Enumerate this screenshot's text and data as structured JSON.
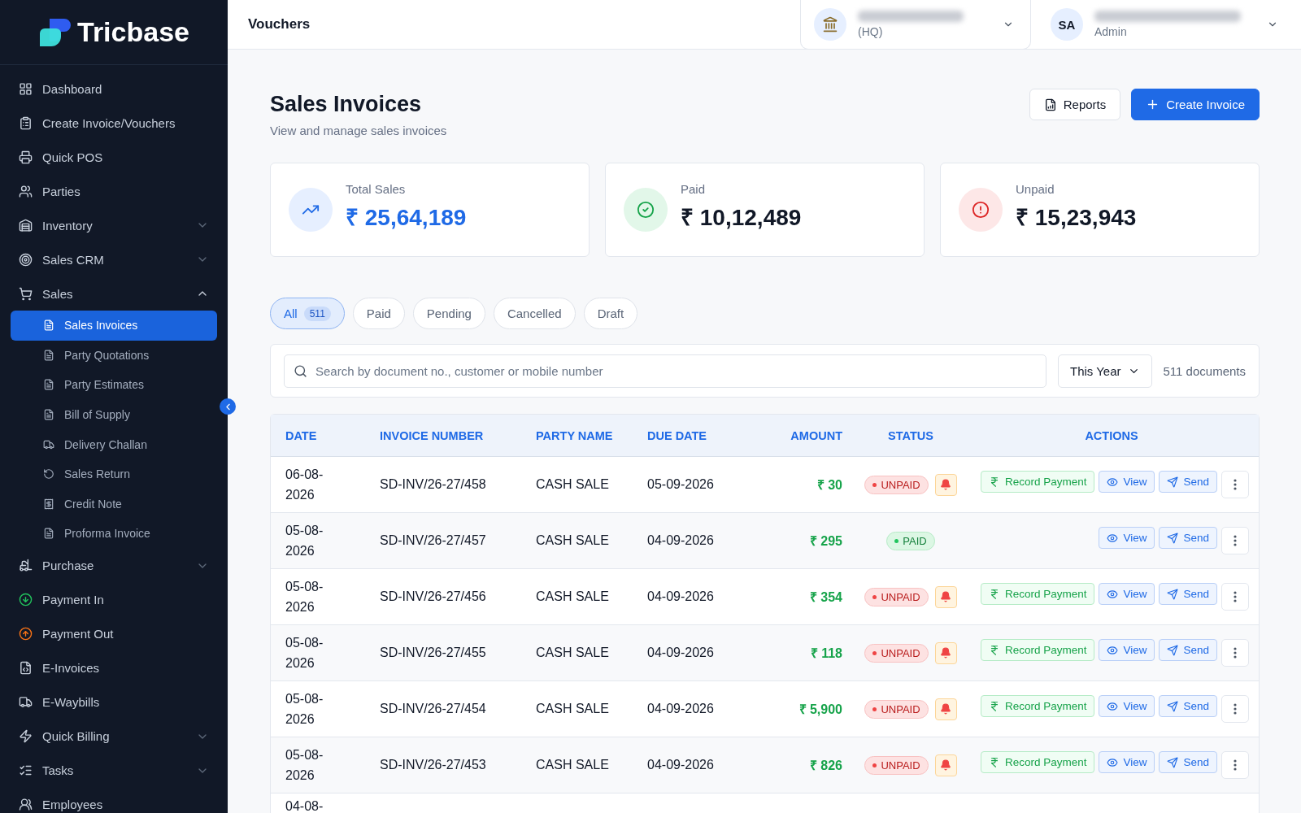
{
  "brand": {
    "name": "Tricbase"
  },
  "sidebar": {
    "items": [
      {
        "label": "Dashboard",
        "kind": "item"
      },
      {
        "label": "Create Invoice/Vouchers",
        "kind": "item"
      },
      {
        "label": "Quick POS",
        "kind": "item"
      },
      {
        "label": "Parties",
        "kind": "item"
      },
      {
        "label": "Inventory",
        "kind": "group",
        "expanded": false
      },
      {
        "label": "Sales CRM",
        "kind": "group",
        "expanded": false
      },
      {
        "label": "Sales",
        "kind": "group",
        "expanded": true,
        "children": [
          {
            "label": "Sales Invoices",
            "selected": true
          },
          {
            "label": "Party Quotations",
            "selected": false
          },
          {
            "label": "Party Estimates",
            "selected": false
          },
          {
            "label": "Bill of Supply",
            "selected": false
          },
          {
            "label": "Delivery Challan",
            "selected": false
          },
          {
            "label": "Sales Return",
            "selected": false
          },
          {
            "label": "Credit Note",
            "selected": false
          },
          {
            "label": "Proforma Invoice",
            "selected": false
          }
        ]
      },
      {
        "label": "Purchase",
        "kind": "group",
        "expanded": false
      },
      {
        "label": "Payment In",
        "kind": "item"
      },
      {
        "label": "Payment Out",
        "kind": "item"
      },
      {
        "label": "E-Invoices",
        "kind": "item"
      },
      {
        "label": "E-Waybills",
        "kind": "item"
      },
      {
        "label": "Quick Billing",
        "kind": "group",
        "expanded": false
      },
      {
        "label": "Tasks",
        "kind": "group",
        "expanded": false
      },
      {
        "label": "Employees",
        "kind": "item"
      }
    ]
  },
  "header": {
    "title": "Vouchers",
    "branch": {
      "subtitle": "(HQ)"
    },
    "user": {
      "initials": "SA",
      "role": "Admin"
    }
  },
  "page": {
    "title": "Sales Invoices",
    "subtitle": "View and manage sales invoices",
    "buttons": [
      {
        "label": "Reports",
        "kind": "secondary"
      },
      {
        "label": "Create Invoice",
        "kind": "primary"
      }
    ]
  },
  "stats": [
    {
      "label": "Total Sales",
      "value": "₹ 25,64,189",
      "kind": "total"
    },
    {
      "label": "Paid",
      "value": "₹ 10,12,489",
      "kind": "paid"
    },
    {
      "label": "Unpaid",
      "value": "₹ 15,23,943",
      "kind": "unpaid"
    }
  ],
  "filters": [
    {
      "label": "All",
      "count": "511",
      "selected": true
    },
    {
      "label": "Paid",
      "selected": false
    },
    {
      "label": "Pending",
      "selected": false
    },
    {
      "label": "Cancelled",
      "selected": false
    },
    {
      "label": "Draft",
      "selected": false
    }
  ],
  "search": {
    "placeholder": "Search by document no., customer or mobile number",
    "period": "This Year",
    "count": "511 documents"
  },
  "table": {
    "columns": [
      "DATE",
      "INVOICE NUMBER",
      "PARTY NAME",
      "DUE DATE",
      "AMOUNT",
      "STATUS",
      "ACTIONS"
    ],
    "rows": [
      {
        "date": "06-08-2026",
        "number": "SD-INV/26-27/458",
        "party": "CASH SALE",
        "due": "05-09-2026",
        "amount": "₹ 30",
        "status": {
          "label": "UNPAID",
          "kind": "unpaid"
        },
        "reminder": true,
        "actions": [
          {
            "label": "Record Payment",
            "kind": "record"
          },
          {
            "label": "View",
            "kind": "view"
          },
          {
            "label": "Send",
            "kind": "send"
          }
        ]
      },
      {
        "date": "05-08-2026",
        "number": "SD-INV/26-27/457",
        "party": "CASH SALE",
        "due": "04-09-2026",
        "amount": "₹ 295",
        "status": {
          "label": "PAID",
          "kind": "paid"
        },
        "reminder": false,
        "actions": [
          {
            "label": "View",
            "kind": "view"
          },
          {
            "label": "Send",
            "kind": "send"
          }
        ]
      },
      {
        "date": "05-08-2026",
        "number": "SD-INV/26-27/456",
        "party": "CASH SALE",
        "due": "04-09-2026",
        "amount": "₹ 354",
        "status": {
          "label": "UNPAID",
          "kind": "unpaid"
        },
        "reminder": true,
        "actions": [
          {
            "label": "Record Payment",
            "kind": "record"
          },
          {
            "label": "View",
            "kind": "view"
          },
          {
            "label": "Send",
            "kind": "send"
          }
        ]
      },
      {
        "date": "05-08-2026",
        "number": "SD-INV/26-27/455",
        "party": "CASH SALE",
        "due": "04-09-2026",
        "amount": "₹ 118",
        "status": {
          "label": "UNPAID",
          "kind": "unpaid"
        },
        "reminder": true,
        "actions": [
          {
            "label": "Record Payment",
            "kind": "record"
          },
          {
            "label": "View",
            "kind": "view"
          },
          {
            "label": "Send",
            "kind": "send"
          }
        ]
      },
      {
        "date": "05-08-2026",
        "number": "SD-INV/26-27/454",
        "party": "CASH SALE",
        "due": "04-09-2026",
        "amount": "₹ 5,900",
        "status": {
          "label": "UNPAID",
          "kind": "unpaid"
        },
        "reminder": true,
        "actions": [
          {
            "label": "Record Payment",
            "kind": "record"
          },
          {
            "label": "View",
            "kind": "view"
          },
          {
            "label": "Send",
            "kind": "send"
          }
        ]
      },
      {
        "date": "05-08-2026",
        "number": "SD-INV/26-27/453",
        "party": "CASH SALE",
        "due": "04-09-2026",
        "amount": "₹ 826",
        "status": {
          "label": "UNPAID",
          "kind": "unpaid"
        },
        "reminder": true,
        "actions": [
          {
            "label": "Record Payment",
            "kind": "record"
          },
          {
            "label": "View",
            "kind": "view"
          },
          {
            "label": "Send",
            "kind": "send"
          }
        ]
      },
      {
        "date": "04-08-"
      }
    ]
  }
}
